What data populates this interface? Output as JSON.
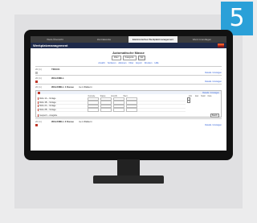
{
  "step_badge": "5",
  "browser_tabs": [
    {
      "label": "Werk-Übersicht",
      "active": false
    },
    {
      "label": "Zentralwerke",
      "active": false
    },
    {
      "label": "Elektronisches Werkplatzmanagement",
      "active": true
    },
    {
      "label": "Werk Grundlagen",
      "active": false
    }
  ],
  "app_title": "Werkplatzmanagement",
  "page_heading": "Automatische Masse",
  "filters": {
    "select1": "Filter",
    "select2": "Kategorie",
    "button": "Go"
  },
  "links": [
    "Ansicht",
    "Sortieren",
    "Aktionen",
    "Filter",
    "Export",
    "Drucken",
    "Hilfe"
  ],
  "sections": [
    {
      "number": "20 (1)",
      "name": "TRUCK",
      "count": "-",
      "link": "Details / Anzeigen"
    },
    {
      "number": "20 (1)",
      "name": "WALKMILL",
      "count": "-",
      "link": "Details / Anzeigen"
    },
    {
      "number": "20 (1)",
      "name": "WALKMILL 1 Kasse",
      "extra": "4+1 Walkern",
      "link": "Details / Anzeigen"
    }
  ],
  "expanded": {
    "header_left": "",
    "header_right": "Details / Anzeigen",
    "columns": [
      "Konsole",
      "Status",
      "Ansicht",
      "Wert"
    ],
    "side_columns": [
      "Info",
      "Zeit",
      "Notiz",
      "Foto"
    ],
    "rows": [
      {
        "label": "Rolle 1A – Vorlage"
      },
      {
        "label": "Rolle 1B – Vorlage"
      },
      {
        "label": "Rolle 2A – Vorlage"
      },
      {
        "label": "Rolle 2B – Vorlage"
      }
    ],
    "gesperrt_label": "Gesperrt – Ausgabe",
    "gesperrt_button": "Bearb."
  },
  "bottom_section": {
    "number": "20 (1)",
    "name": "WALKMILL 2 Kasse",
    "extra": "4+1 Walkern",
    "link": "Details / Anzeigen"
  }
}
